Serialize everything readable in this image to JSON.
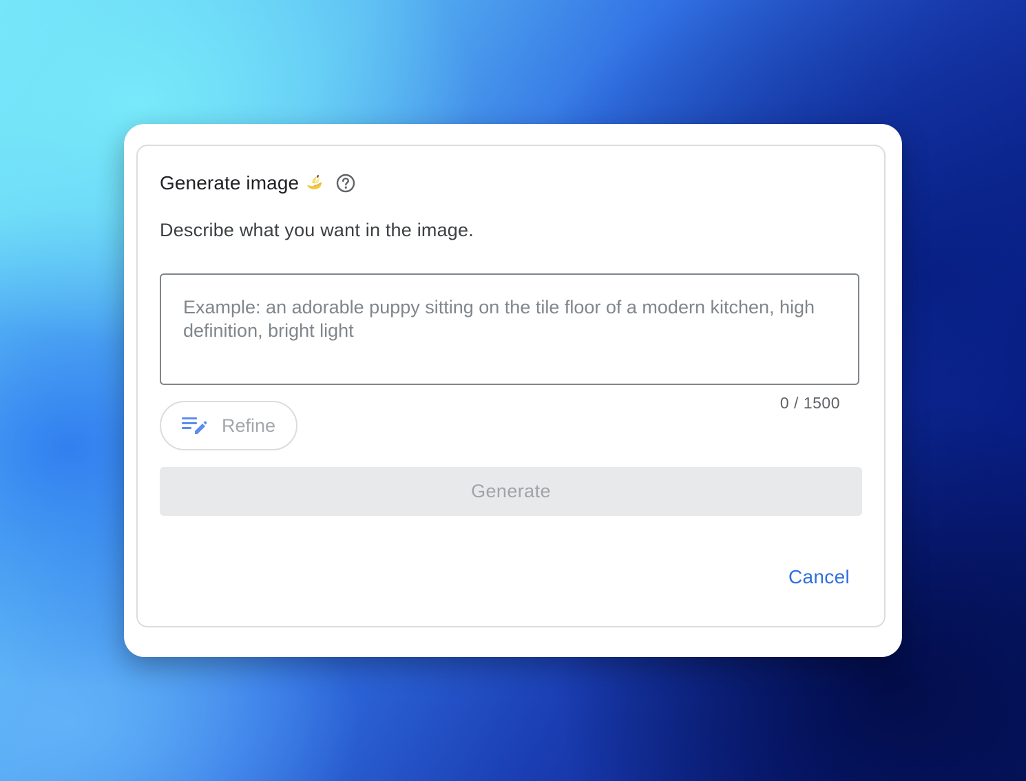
{
  "dialog": {
    "title": "Generate image",
    "title_emoji_icon": "banana-icon",
    "help_icon": "help-circle-icon",
    "description": "Describe what you want in the image.",
    "prompt": {
      "value": "",
      "placeholder": "Example: an adorable puppy sitting on the tile floor of a modern kitchen, high definition, bright light"
    },
    "char_count": "0 / 1500",
    "refine_button": {
      "label": "Refine",
      "icon": "edit-note-icon"
    },
    "generate_button": {
      "label": "Generate"
    },
    "cancel_button": {
      "label": "Cancel"
    }
  },
  "colors": {
    "accent": "#2f6fe0",
    "refine_icon": "#5b8def",
    "disabled_text": "#a0a3a7",
    "disabled_bg": "#e8e9ea"
  }
}
